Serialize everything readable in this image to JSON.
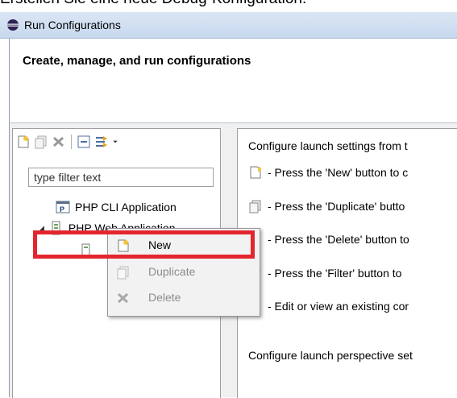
{
  "caption": "Erstellen Sie eine neue Debug-Konfiguration.",
  "window": {
    "title": "Run Configurations"
  },
  "banner": {
    "heading": "Create, manage, and run configurations"
  },
  "filter": {
    "placeholder": "type filter text"
  },
  "tree": {
    "items": [
      {
        "label": "PHP CLI Application"
      },
      {
        "label": "PHP Web Application",
        "expanded": true
      }
    ]
  },
  "context_menu": {
    "items": [
      {
        "label": "New",
        "enabled": true
      },
      {
        "label": "Duplicate",
        "enabled": false
      },
      {
        "label": "Delete",
        "enabled": false
      }
    ]
  },
  "right_pane": {
    "intro": "Configure launch settings from t",
    "lines": [
      "- Press the 'New' button to c",
      "- Press the 'Duplicate' butto",
      "- Press the 'Delete' button to",
      "- Press the 'Filter' button to",
      "- Edit or view an existing cor"
    ],
    "footer": "Configure launch perspective set"
  },
  "colors": {
    "highlight": "#e3262e",
    "titlebar": "#c7d8ee"
  }
}
